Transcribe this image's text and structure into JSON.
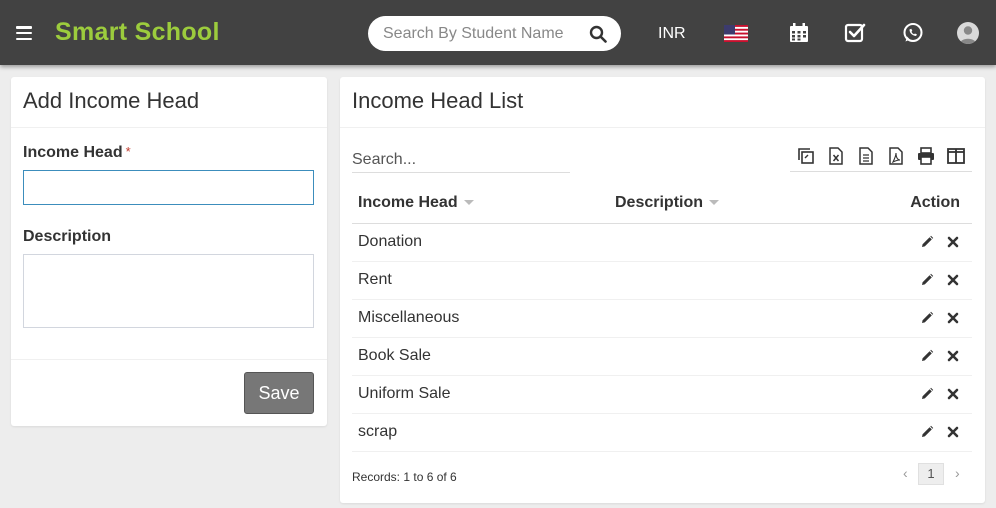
{
  "header": {
    "brand": "Smart School",
    "search_placeholder": "Search By Student Name",
    "currency": "INR",
    "icons": [
      "menu-icon",
      "search-icon",
      "us-flag-icon",
      "calendar-icon",
      "tasks-checkbox-icon",
      "whatsapp-icon",
      "user-avatar-icon"
    ]
  },
  "add_form": {
    "title": "Add Income Head",
    "income_head_label": "Income Head",
    "required_mark": "*",
    "income_head_value": "",
    "description_label": "Description",
    "description_value": "",
    "save_label": "Save"
  },
  "list": {
    "title": "Income Head List",
    "search_placeholder": "Search...",
    "toolbar_icons": [
      "copy-icon",
      "excel-icon",
      "csv-icon",
      "pdf-icon",
      "print-icon",
      "columns-icon"
    ],
    "columns": [
      "Income Head",
      "Description",
      "Action"
    ],
    "rows": [
      {
        "income_head": "Donation",
        "description": ""
      },
      {
        "income_head": "Rent",
        "description": ""
      },
      {
        "income_head": "Miscellaneous",
        "description": ""
      },
      {
        "income_head": "Book Sale",
        "description": ""
      },
      {
        "income_head": "Uniform Sale",
        "description": ""
      },
      {
        "income_head": "scrap",
        "description": ""
      }
    ],
    "records_text": "Records: 1 to 6 of 6",
    "pagination": {
      "prev": "‹",
      "current_page": "1",
      "next": "›"
    }
  },
  "colors": {
    "header_bg": "#424242",
    "brand": "#9ccc3d",
    "save_button": "#777777",
    "page_bg": "#ededed"
  }
}
